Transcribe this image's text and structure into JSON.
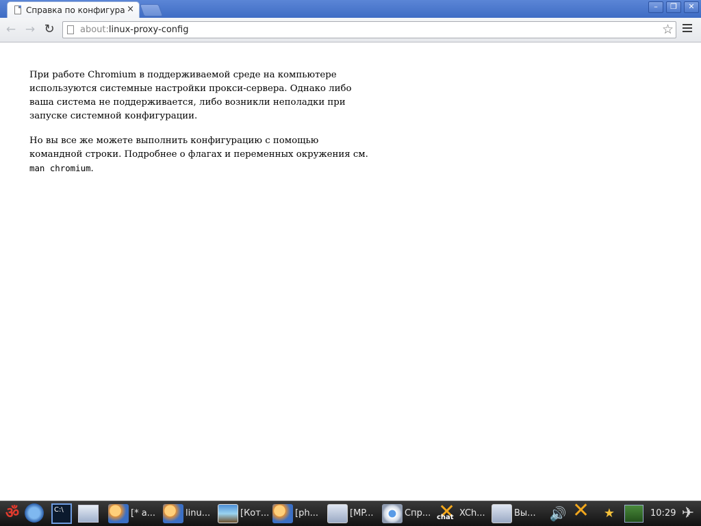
{
  "window": {
    "tab_title": "Справка по конфигурации",
    "tab_close": "×",
    "btn_minimize": "–",
    "btn_maximize": "❐",
    "btn_close": "✕"
  },
  "toolbar": {
    "back_icon": "←",
    "forward_icon": "→",
    "reload_icon": "↻",
    "url_scheme": "about:",
    "url_path": "linux-proxy-config",
    "star_icon": "☆"
  },
  "content": {
    "paragraph1": "При работе Chromium в поддерживаемой среде на компьютере используются системные настройки прокси-сервера. Однако либо ваша система не поддерживается, либо возникли неполадки при запуске системной конфигурации.",
    "paragraph2_prefix": "Но вы все же можете выполнить конфигурацию с помощью командной строки. Подробнее о флагах и переменных окружения см.",
    "paragraph2_code": "man chromium",
    "paragraph2_suffix": "."
  },
  "taskbar": {
    "start_icon": "ॐ",
    "tasks": [
      {
        "label": "[* a...",
        "icon": "users-icon"
      },
      {
        "label": "linu...",
        "icon": "users-icon"
      },
      {
        "label": "[Кот...",
        "icon": "image-icon"
      },
      {
        "label": "[ph...",
        "icon": "users-icon"
      },
      {
        "label": "[MP...",
        "icon": "window-icon"
      },
      {
        "label": "Спр...",
        "icon": "chromium-icon"
      },
      {
        "label": "XCh...",
        "icon": "xchat-icon"
      },
      {
        "label": "Вы...",
        "icon": "window-icon"
      }
    ],
    "clock": "10:29"
  }
}
